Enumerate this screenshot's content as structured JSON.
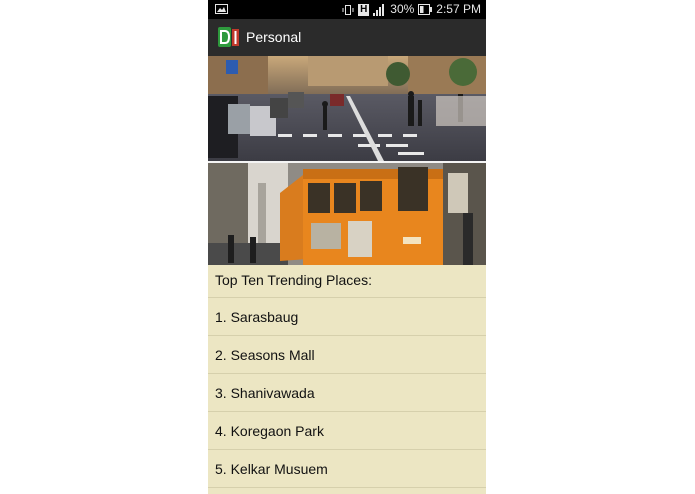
{
  "status_bar": {
    "network_badge": "H",
    "battery_percent": "30%",
    "time": "2:57 PM",
    "icons": [
      "image-notification-icon",
      "vibrate-icon",
      "network-type-icon",
      "signal-icon",
      "battery-icon"
    ]
  },
  "action_bar": {
    "title": "Personal",
    "logo_icon": "app-logo-icon"
  },
  "banners": [
    "street-crossing-photo",
    "orange-tram-photo"
  ],
  "list": {
    "header": "Top Ten Trending Places:",
    "items": [
      {
        "label": "1. Sarasbaug"
      },
      {
        "label": "2. Seasons Mall"
      },
      {
        "label": "3. Shanivawada"
      },
      {
        "label": "4. Koregaon Park"
      },
      {
        "label": "5. Kelkar Musuem"
      }
    ]
  },
  "colors": {
    "status_bar_bg": "#000000",
    "action_bar_bg": "#2b2b2b",
    "list_bg": "#ece6c3",
    "tram_orange": "#e8861e"
  }
}
